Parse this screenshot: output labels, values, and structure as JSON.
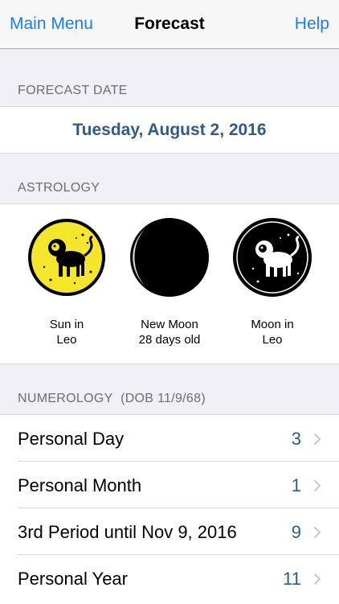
{
  "nav": {
    "left": "Main Menu",
    "title": "Forecast",
    "right": "Help"
  },
  "forecast_date": {
    "header": "FORECAST DATE",
    "value": "Tuesday, August 2, 2016"
  },
  "astrology": {
    "header": "ASTROLOGY",
    "items": [
      {
        "label": "Sun in\nLeo",
        "icon": "sun-leo-icon"
      },
      {
        "label": "New Moon\n28 days old",
        "icon": "new-moon-icon"
      },
      {
        "label": "Moon in\nLeo",
        "icon": "moon-leo-icon"
      }
    ]
  },
  "numerology": {
    "header": "NUMEROLOGY",
    "dob": "(DOB 11/9/68)",
    "rows": [
      {
        "label": "Personal Day",
        "value": "3"
      },
      {
        "label": "Personal Month",
        "value": "1"
      },
      {
        "label": "3rd Period until Nov 9, 2016",
        "value": "9"
      },
      {
        "label": "Personal Year",
        "value": "11"
      }
    ]
  },
  "colors": {
    "accent": "#1a7df5",
    "value_text": "#2f5a8a",
    "sun_yellow": "#f4e62a"
  }
}
